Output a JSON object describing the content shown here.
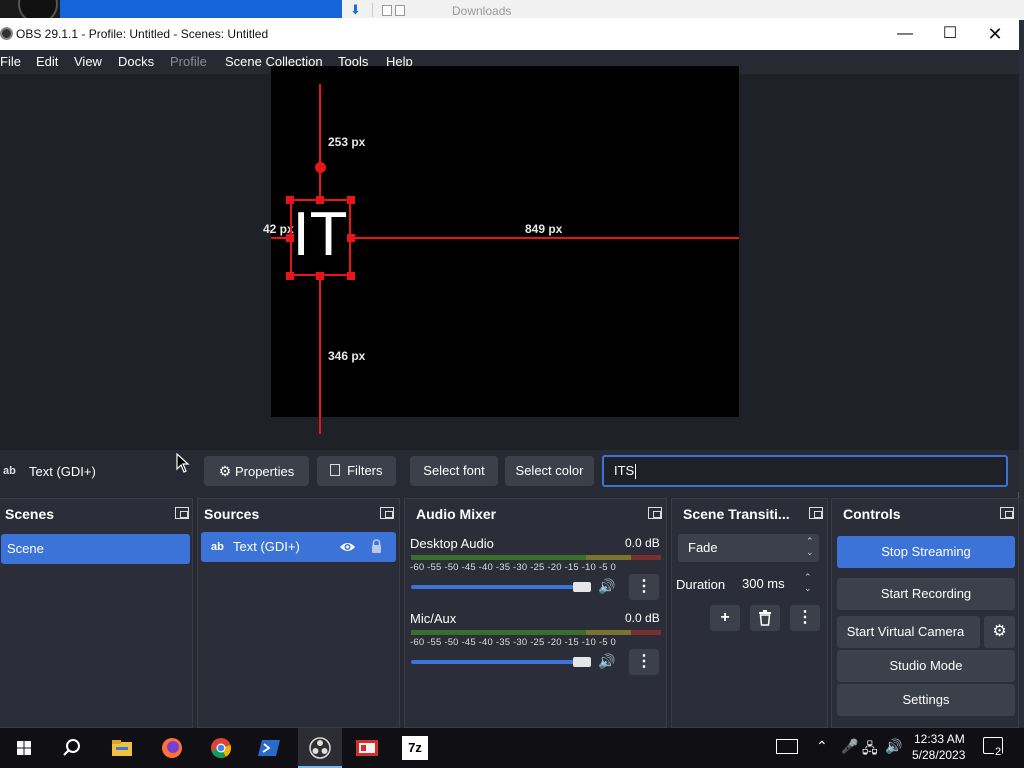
{
  "background": {
    "explorer_text": "Downloads"
  },
  "window": {
    "title": "OBS 29.1.1 - Profile: Untitled - Scenes: Untitled",
    "controls": {
      "minimize": "—",
      "maximize": "☐",
      "close": "✕"
    }
  },
  "menu": {
    "items": [
      "File",
      "Edit",
      "View",
      "Docks",
      "Profile",
      "Scene Collection",
      "Tools",
      "Help"
    ]
  },
  "preview": {
    "source_text": "IT",
    "measure_top": "253 px",
    "measure_left": "42 px",
    "measure_right": "849 px",
    "measure_bottom": "346 px"
  },
  "context_bar": {
    "source_icon": "ab",
    "source_name": "Text (GDI+)",
    "properties_label": "Properties",
    "filters_label": "Filters",
    "select_font_label": "Select font",
    "select_color_label": "Select color",
    "text_value": "ITS"
  },
  "scenes": {
    "title": "Scenes",
    "items": [
      "Scene"
    ]
  },
  "sources": {
    "title": "Sources",
    "items": [
      {
        "icon": "ab",
        "name": "Text (GDI+)"
      }
    ]
  },
  "mixer": {
    "title": "Audio Mixer",
    "ticks": "-60 -55 -50 -45 -40 -35 -30 -25 -20 -15 -10 -5 0",
    "channels": [
      {
        "name": "Desktop Audio",
        "level": "0.0 dB",
        "volume": 1.0
      },
      {
        "name": "Mic/Aux",
        "level": "0.0 dB",
        "volume": 1.0
      }
    ]
  },
  "transitions": {
    "title": "Scene Transiti...",
    "selected": "Fade",
    "duration_label": "Duration",
    "duration_value": "300 ms"
  },
  "controls": {
    "title": "Controls",
    "stop_streaming": "Stop Streaming",
    "start_recording": "Start Recording",
    "start_virtual_camera": "Start Virtual Camera",
    "studio_mode": "Studio Mode",
    "settings": "Settings"
  },
  "taskbar": {
    "time": "12:33 AM",
    "date": "5/28/2023",
    "notification_count": "2",
    "app_7z": "7z"
  },
  "colors": {
    "accent": "#3c73d9",
    "guide_red": "#e8151b",
    "panel_bg": "#2b2e38",
    "button_bg": "#3c404b"
  }
}
